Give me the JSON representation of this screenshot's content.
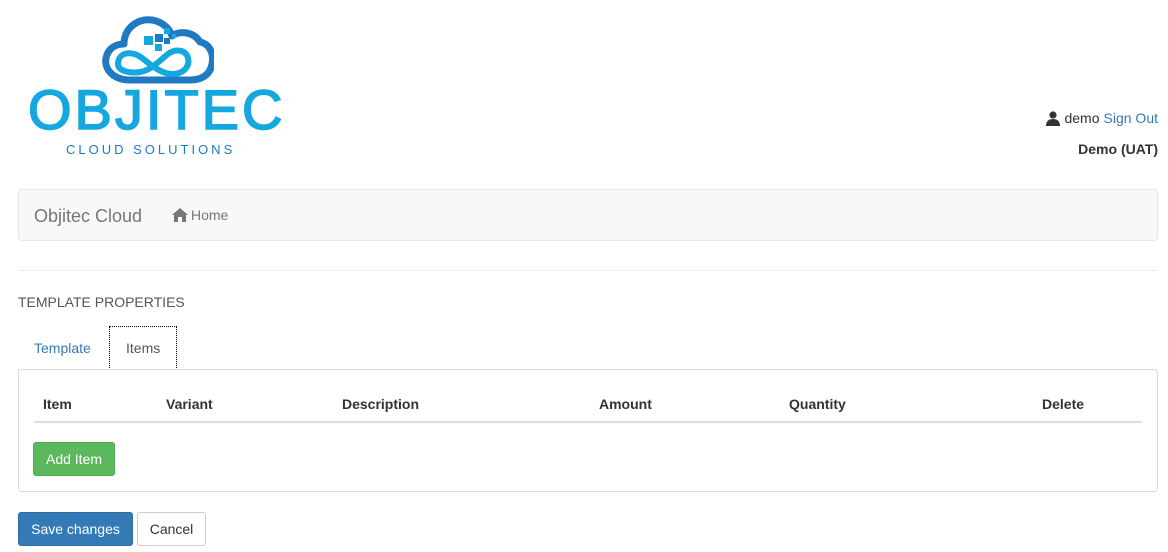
{
  "logo": {
    "wordmark": "OBJITEC",
    "tagline": "CLOUD SOLUTIONS",
    "colors": {
      "primary": "#14a7e0",
      "secondary": "#1f7ac2"
    }
  },
  "user": {
    "icon": "user-icon",
    "name": "demo",
    "sign_out": "Sign Out",
    "environment": "Demo (UAT)"
  },
  "navbar": {
    "brand": "Objitec Cloud",
    "home_icon": "home-icon",
    "home_label": "Home"
  },
  "section_title": "TEMPLATE PROPERTIES",
  "tabs": [
    {
      "label": "Template",
      "active": false
    },
    {
      "label": "Items",
      "active": true
    }
  ],
  "items_table": {
    "columns": [
      "Item",
      "Variant",
      "Description",
      "Amount",
      "Quantity",
      "Delete"
    ],
    "rows": []
  },
  "buttons": {
    "add_item": "Add Item",
    "save": "Save changes",
    "cancel": "Cancel"
  },
  "colors": {
    "link": "#337ab7",
    "success": "#5cb85c",
    "primary_button": "#337ab7"
  }
}
